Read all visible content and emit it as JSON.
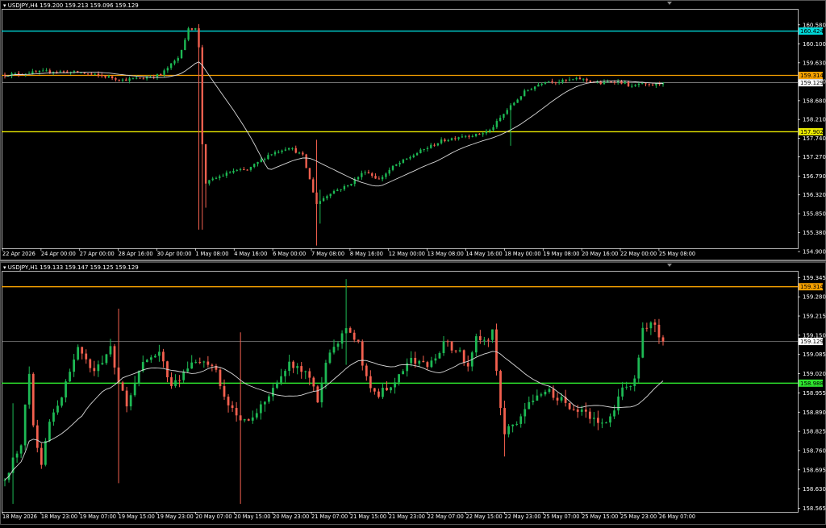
{
  "theme": {
    "background": "#000000",
    "frame": "#ffffff",
    "axis_text": "#ffffff",
    "bull": "#1db954",
    "bear": "#f4604f",
    "ma": "#d8d8d8",
    "price_line": "#9a9a9a"
  },
  "charts": [
    {
      "id": "h4",
      "header": "USDJPY,H4  159.200 159.213 159.096 159.129",
      "yticks": [
        "160.580",
        "160.100",
        "159.630",
        "159.160",
        "158.680",
        "158.210",
        "157.740",
        "157.270",
        "156.790",
        "156.320",
        "155.850",
        "155.380",
        "154.900"
      ],
      "xticks": [
        "22 Apr 2026",
        "24 Apr 00:00",
        "27 Apr 00:00",
        "28 Apr 16:00",
        "30 Apr 00:00",
        "1 May 08:00",
        "4 May 16:00",
        "6 May 00:00",
        "7 May 08:00",
        "8 May 16:00",
        "12 May 00:00",
        "13 May 08:00",
        "14 May 16:00",
        "18 May 00:00",
        "19 May 08:00",
        "20 May 16:00",
        "22 May 00:00",
        "25 May 08:00"
      ],
      "levels": [
        {
          "label": "160.424",
          "color": "#00d8d8"
        },
        {
          "label": "159.314",
          "color": "#f5a000"
        },
        {
          "label": "157.902",
          "color": "#e8e800"
        }
      ],
      "current_price": "159.129"
    },
    {
      "id": "h1",
      "header": "USDJPY,H1  159.133 159.147 159.125 159.129",
      "yticks": [
        "159.345",
        "159.280",
        "159.215",
        "159.150",
        "159.085",
        "159.020",
        "158.955",
        "158.890",
        "158.825",
        "158.760",
        "158.695",
        "158.630",
        "158.565"
      ],
      "xticks": [
        "18 May 2026",
        "18 May 23:00",
        "19 May 07:00",
        "19 May 15:00",
        "19 May 23:00",
        "20 May 07:00",
        "20 May 15:00",
        "20 May 23:00",
        "21 May 07:00",
        "21 May 15:00",
        "21 May 23:00",
        "22 May 07:00",
        "22 May 15:00",
        "22 May 23:00",
        "25 May 07:00",
        "25 May 15:00",
        "25 May 23:00",
        "26 May 07:00"
      ],
      "levels": [
        {
          "label": "159.314",
          "color": "#f5a000"
        },
        {
          "label": "158.988",
          "color": "#2ee82e"
        }
      ],
      "current_price": "159.129"
    }
  ],
  "chart_data": [
    {
      "type": "candlestick",
      "title": "USDJPY,H4",
      "ylim": [
        154.78,
        160.96
      ],
      "horizontal_levels": [
        160.424,
        159.314,
        157.902
      ],
      "last_price": 159.129,
      "path_points": [
        [
          0,
          159.33
        ],
        [
          14,
          159.42
        ],
        [
          22,
          159.38
        ],
        [
          30,
          159.27
        ],
        [
          34,
          159.2
        ],
        [
          40,
          159.25
        ],
        [
          45,
          159.33
        ],
        [
          50,
          159.75
        ],
        [
          53,
          160.46
        ],
        [
          55,
          160.52
        ],
        [
          56,
          160.0
        ],
        [
          57,
          157.6
        ],
        [
          58,
          156.62
        ],
        [
          62,
          156.78
        ],
        [
          66,
          156.92
        ],
        [
          70,
          156.94
        ],
        [
          76,
          157.32
        ],
        [
          82,
          157.52
        ],
        [
          86,
          157.3
        ],
        [
          90,
          156.1
        ],
        [
          94,
          156.38
        ],
        [
          99,
          156.55
        ],
        [
          104,
          156.92
        ],
        [
          108,
          156.7
        ],
        [
          112,
          157.02
        ],
        [
          120,
          157.42
        ],
        [
          126,
          157.67
        ],
        [
          132,
          157.8
        ],
        [
          136,
          157.82
        ],
        [
          140,
          157.93
        ],
        [
          145,
          158.45
        ],
        [
          150,
          158.9
        ],
        [
          156,
          159.18
        ],
        [
          160,
          159.16
        ],
        [
          166,
          159.23
        ],
        [
          172,
          159.11
        ],
        [
          176,
          159.18
        ],
        [
          179,
          159.12
        ],
        [
          181,
          159.02
        ],
        [
          183,
          159.1
        ],
        [
          186,
          159.05
        ],
        [
          190,
          159.13
        ]
      ],
      "wick_spikes": [
        {
          "i": 56,
          "hi": 160.6,
          "lo": 155.45
        },
        {
          "i": 57,
          "hi": 157.55,
          "lo": 155.45
        },
        {
          "i": 58,
          "hi": 157.1,
          "lo": 156.0
        },
        {
          "i": 90,
          "hi": 157.7,
          "lo": 155.05
        },
        {
          "i": 91,
          "hi": 156.45,
          "lo": 155.6
        },
        {
          "i": 146,
          "hi": 158.55,
          "lo": 157.55
        }
      ],
      "ma_period": 20
    },
    {
      "type": "candlestick",
      "title": "USDJPY,H1",
      "ylim": [
        158.55,
        159.365
      ],
      "horizontal_levels": [
        159.314,
        158.988
      ],
      "last_price": 159.129,
      "path_points": [
        [
          0,
          158.66
        ],
        [
          4,
          158.79
        ],
        [
          6,
          159.02
        ],
        [
          7,
          158.84
        ],
        [
          9,
          158.72
        ],
        [
          11,
          158.86
        ],
        [
          14,
          158.95
        ],
        [
          18,
          159.1
        ],
        [
          22,
          159.02
        ],
        [
          26,
          159.1
        ],
        [
          30,
          158.9
        ],
        [
          34,
          159.07
        ],
        [
          38,
          159.09
        ],
        [
          41,
          158.97
        ],
        [
          45,
          159.05
        ],
        [
          49,
          159.06
        ],
        [
          52,
          159.03
        ],
        [
          54,
          158.93
        ],
        [
          58,
          158.86
        ],
        [
          60,
          158.86
        ],
        [
          64,
          158.93
        ],
        [
          67,
          158.99
        ],
        [
          70,
          159.05
        ],
        [
          74,
          159.03
        ],
        [
          77,
          158.93
        ],
        [
          80,
          159.1
        ],
        [
          84,
          159.17
        ],
        [
          87,
          159.12
        ],
        [
          89,
          159.0
        ],
        [
          92,
          158.95
        ],
        [
          96,
          159.0
        ],
        [
          100,
          159.07
        ],
        [
          104,
          159.04
        ],
        [
          108,
          159.12
        ],
        [
          112,
          159.1
        ],
        [
          114,
          159.04
        ],
        [
          116,
          159.16
        ],
        [
          118,
          159.13
        ],
        [
          120,
          159.16
        ],
        [
          122,
          158.9
        ],
        [
          123,
          158.82
        ],
        [
          126,
          158.86
        ],
        [
          130,
          158.94
        ],
        [
          134,
          158.96
        ],
        [
          138,
          158.92
        ],
        [
          141,
          158.89
        ],
        [
          144,
          158.88
        ],
        [
          147,
          158.85
        ],
        [
          150,
          158.9
        ],
        [
          152,
          158.96
        ],
        [
          155,
          159.0
        ],
        [
          157,
          159.17
        ],
        [
          159,
          159.2
        ],
        [
          161,
          159.15
        ],
        [
          162,
          159.13
        ]
      ],
      "wick_spikes": [
        {
          "i": 2,
          "hi": 158.92,
          "lo": 158.58
        },
        {
          "i": 28,
          "hi": 159.24,
          "lo": 158.65
        },
        {
          "i": 58,
          "hi": 159.16,
          "lo": 158.58
        },
        {
          "i": 84,
          "hi": 159.34,
          "lo": 159.05
        },
        {
          "i": 123,
          "hi": 158.9,
          "lo": 158.74
        }
      ],
      "ma_period": 20
    }
  ]
}
